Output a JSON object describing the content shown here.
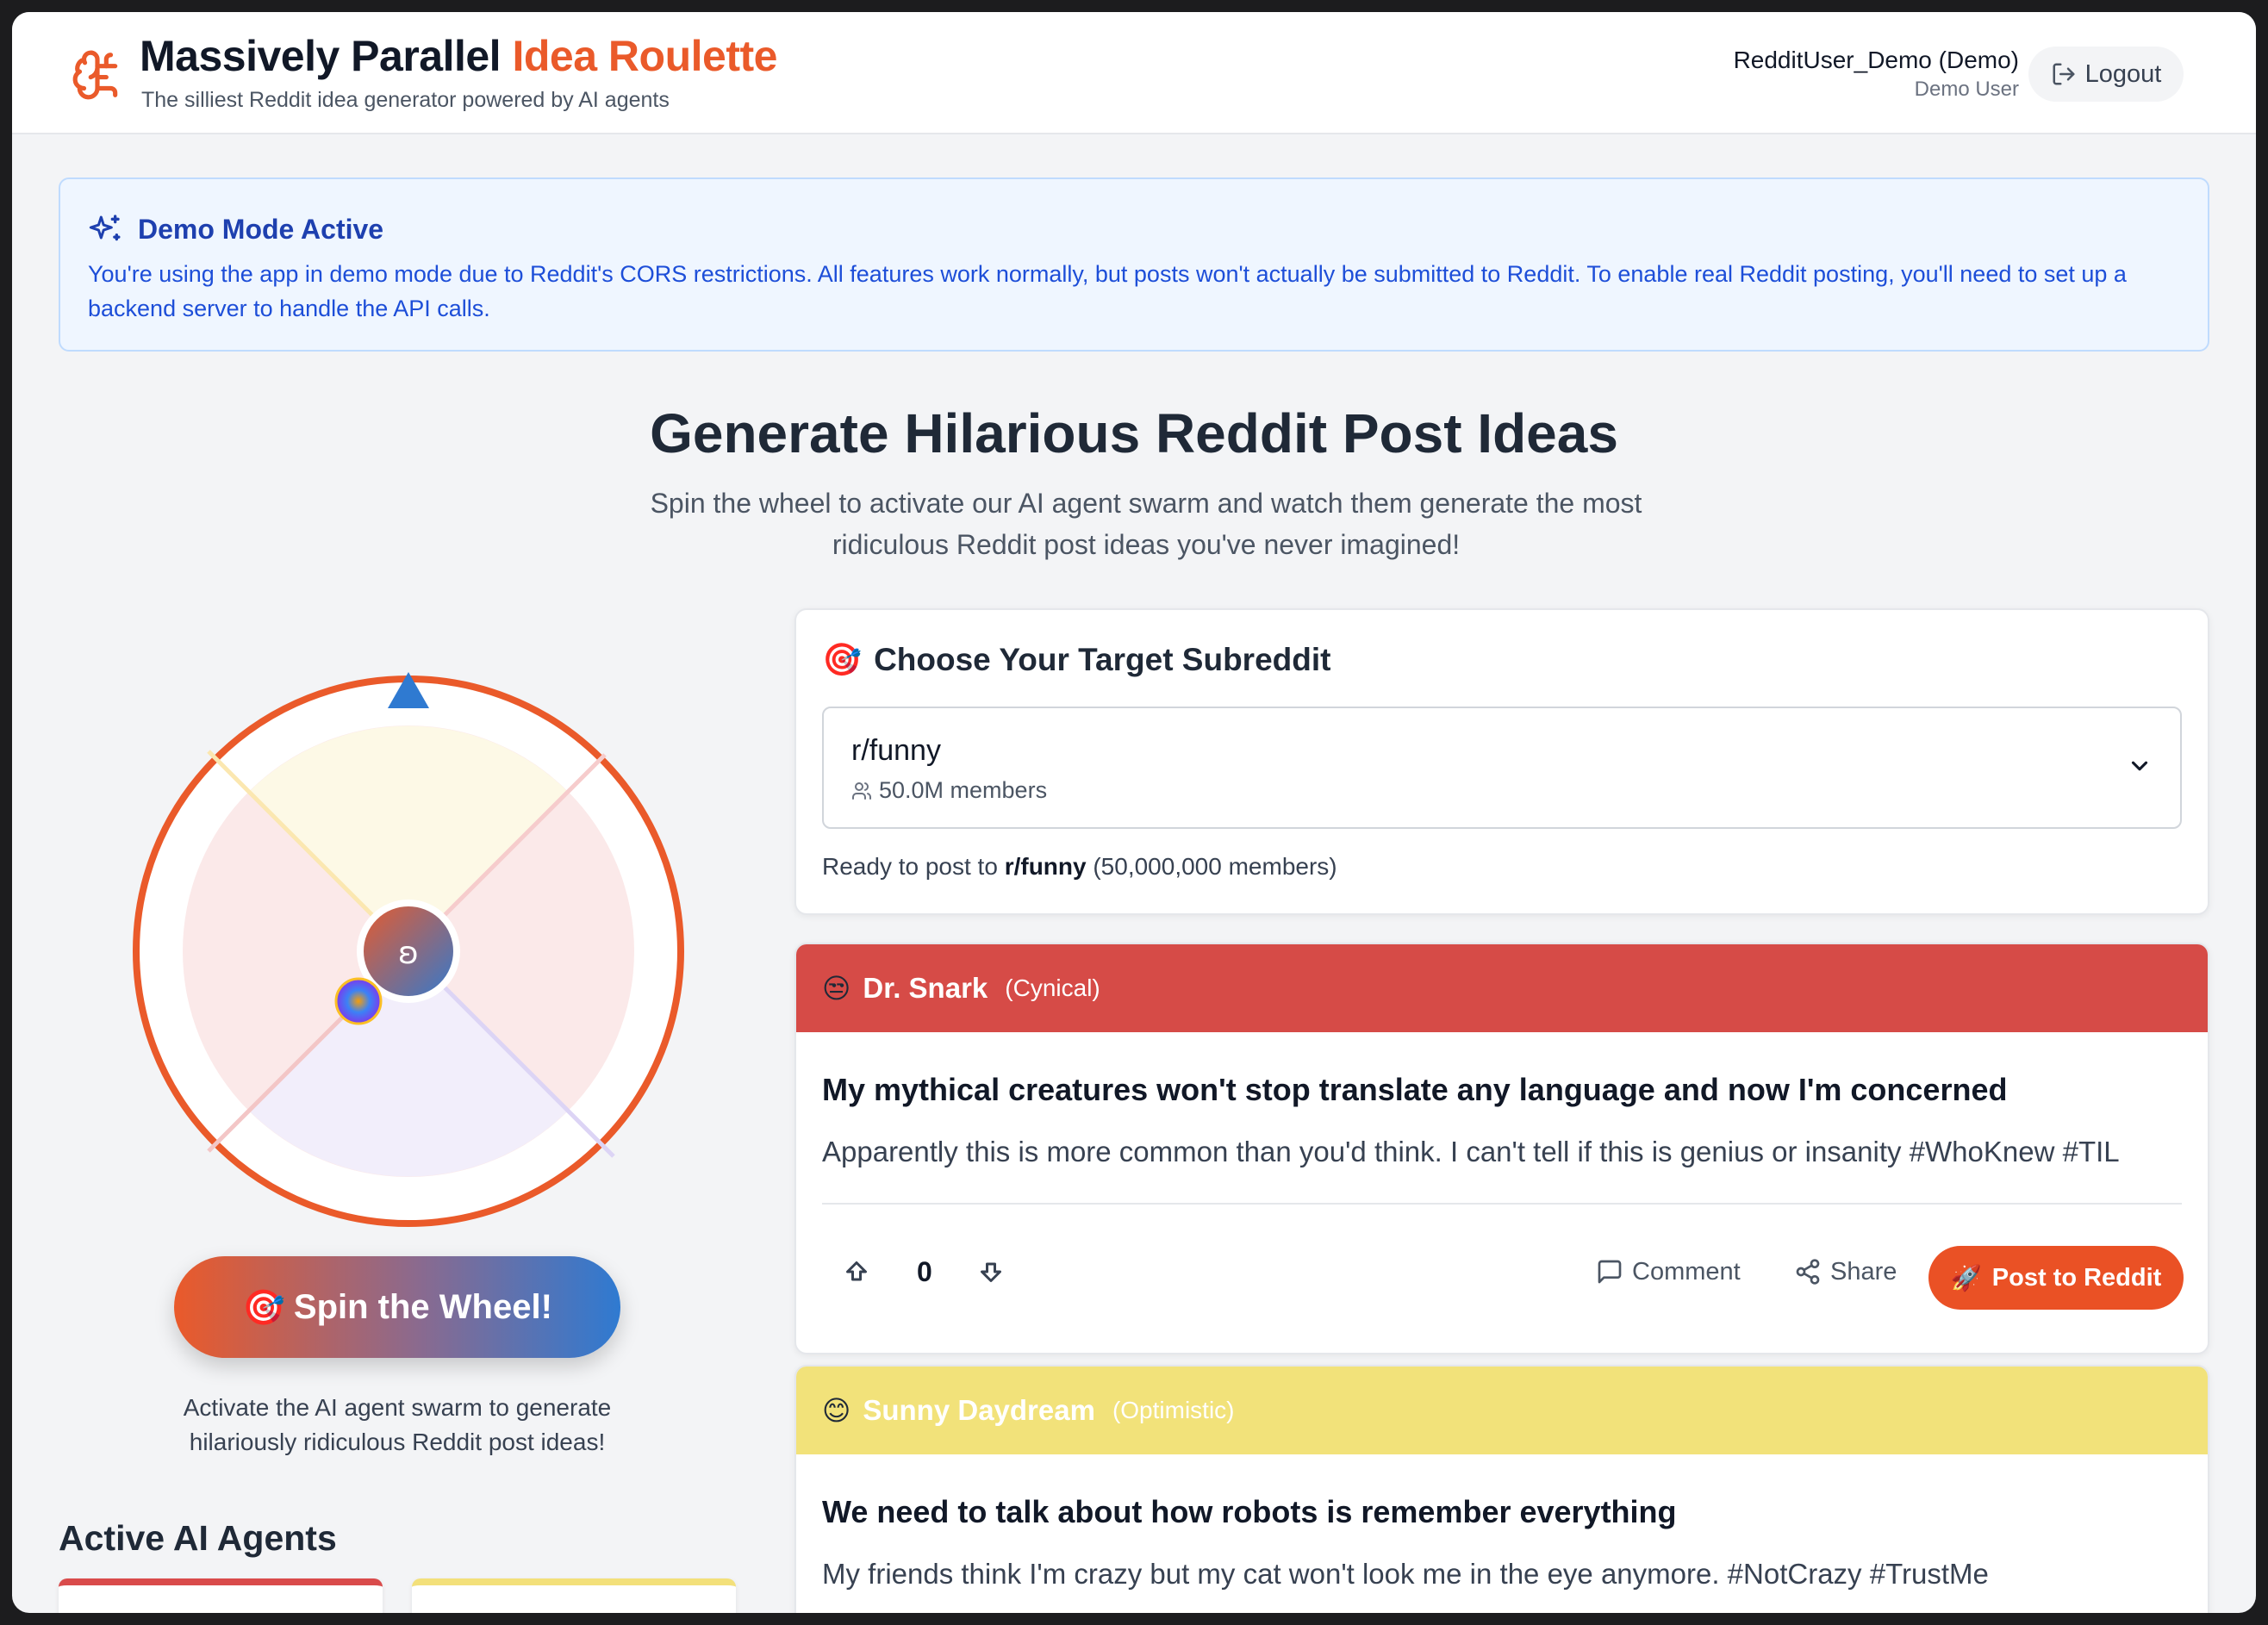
{
  "header": {
    "title_main": "Massively Parallel",
    "title_accent": "Idea Roulette",
    "subtitle": "The silliest Reddit idea generator powered by AI agents",
    "user_name": "RedditUser_Demo (Demo)",
    "user_role": "Demo User",
    "logout_label": "Logout"
  },
  "banner": {
    "title": "Demo Mode Active",
    "text": "You're using the app in demo mode due to Reddit's CORS restrictions. All features work normally, but posts won't actually be submitted to Reddit. To enable real Reddit posting, you'll need to set up a backend server to handle the API calls."
  },
  "hero": {
    "title": "Generate Hilarious Reddit Post Ideas",
    "subtitle": "Spin the wheel to activate our AI agent swarm and watch them generate the most ridiculous Reddit post ideas you've never imagined!"
  },
  "wheel": {
    "spin_label": "Spin the Wheel!",
    "spin_emoji": "🎯",
    "caption": "Activate the AI agent swarm to generate hilariously ridiculous Reddit post ideas!"
  },
  "agents_section": {
    "heading": "Active AI Agents"
  },
  "subreddit": {
    "title": "Choose Your Target Subreddit",
    "title_emoji": "🎯",
    "selected": "r/funny",
    "members": "50.0M members",
    "ready_prefix": "Ready to post to",
    "ready_sub": "r/funny",
    "ready_suffix": "(50,000,000 members)"
  },
  "ideas": [
    {
      "emoji": "😒",
      "agent": "Dr. Snark",
      "mood": "(Cynical)",
      "color": "#d64b47",
      "title": "My mythical creatures won't stop translate any language and now I'm concerned",
      "body": "Apparently this is more common than you'd think. I can't tell if this is genius or insanity #WhoKnew #TIL",
      "votes": "0",
      "comment_label": "Comment",
      "share_label": "Share",
      "post_label": "Post to Reddit",
      "post_emoji": "🚀"
    },
    {
      "emoji": "😊",
      "agent": "Sunny Daydream",
      "mood": "(Optimistic)",
      "color": "#f2e27a",
      "title": "We need to talk about how robots is remember everything",
      "body": "My friends think I'm crazy but my cat won't look me in the eye anymore. #NotCrazy #TrustMe"
    }
  ],
  "colors": {
    "brand_orange": "#ea5a2a",
    "brand_blue": "#2f7ad1",
    "banner_blue": "#1e40af"
  }
}
